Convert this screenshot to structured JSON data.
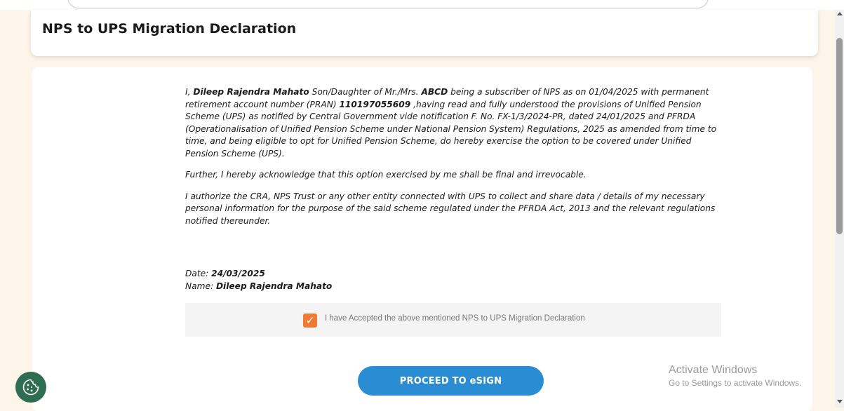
{
  "page_title": "NPS to UPS Migration Declaration",
  "declaration": {
    "p1": {
      "t1": "I, ",
      "name": "Dileep Rajendra Mahato",
      "t2": " Son/Daughter of Mr./Mrs. ",
      "parent": "ABCD",
      "t3": " being a subscriber of NPS as on 01/04/2025 with permanent retirement account number (PRAN) ",
      "pran": "110197055609",
      "t4": " ,having read and fully understood the provisions of Unified Pension Scheme (UPS) as notified by Central Government vide notification F. No. FX-1/3/2024-PR, dated 24/01/2025 and PFRDA (Operationalisation of Unified Pension Scheme under National Pension System) Regulations, 2025 as amended from time to time, and being eligible to opt for Unified Pension Scheme, do hereby exercise the option to be covered under Unified Pension Scheme (UPS)."
    },
    "p2": "Further, I hereby acknowledge that this option exercised by me shall be final and irrevocable.",
    "p3": "I authorize the CRA, NPS Trust or any other entity connected with UPS to collect and share data / details of my necessary personal information for the purpose of the said scheme regulated under the PFRDA Act, 2013 and the relevant regulations notified thereunder."
  },
  "meta": {
    "date_label": "Date: ",
    "date_value": "24/03/2025",
    "name_label": "Name: ",
    "name_value": "Dileep Rajendra Mahato"
  },
  "acceptance": {
    "checked": true,
    "label": "I have Accepted the above mentioned NPS to UPS Migration Declaration"
  },
  "buttons": {
    "proceed": "PROCEED TO eSIGN"
  },
  "watermark": {
    "line1": "Activate Windows",
    "line2": "Go to Settings to activate Windows."
  },
  "icons": {
    "checkbox": "check-icon",
    "cookie": "cookie-icon"
  },
  "colors": {
    "accent": "#2a8dd4",
    "checkbox": "#f07a32",
    "cookie_button": "#2f6d52",
    "page_bg": "#fdf4ea"
  }
}
